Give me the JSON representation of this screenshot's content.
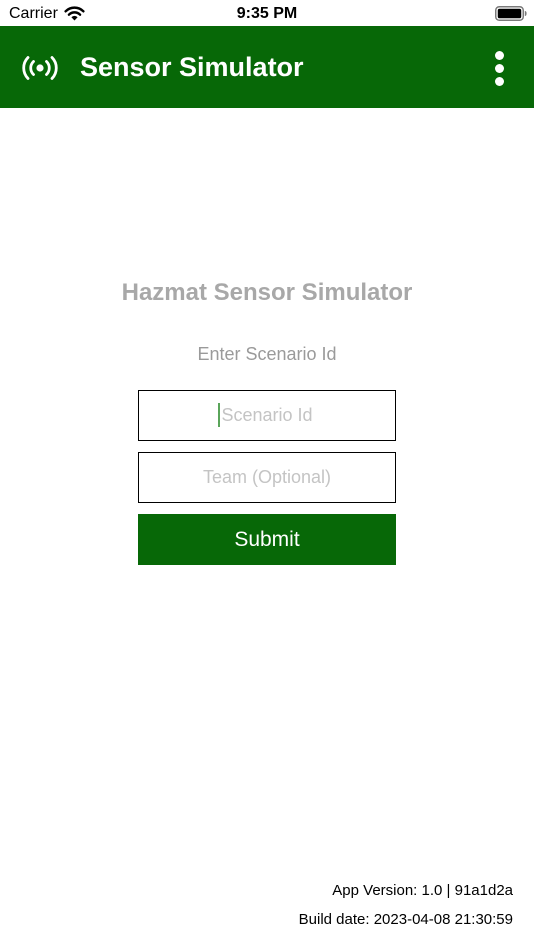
{
  "status_bar": {
    "carrier": "Carrier",
    "time": "9:35 PM",
    "wifi_icon": "wifi-icon",
    "battery_icon": "battery-full-icon"
  },
  "app_bar": {
    "title": "Sensor Simulator",
    "icon": "broadcast-signal-icon",
    "menu_icon": "more-vertical-icon",
    "background_color": "#076807"
  },
  "form": {
    "heading": "Hazmat Sensor Simulator",
    "subheading": "Enter Scenario Id",
    "scenario_id": {
      "placeholder": "Scenario Id",
      "value": ""
    },
    "team": {
      "placeholder": "Team (Optional)",
      "value": ""
    },
    "submit_label": "Submit",
    "accent_color": "#076807"
  },
  "footer": {
    "app_version": "App Version: 1.0 | 91a1d2a",
    "build_date": "Build date: 2023-04-08 21:30:59"
  }
}
